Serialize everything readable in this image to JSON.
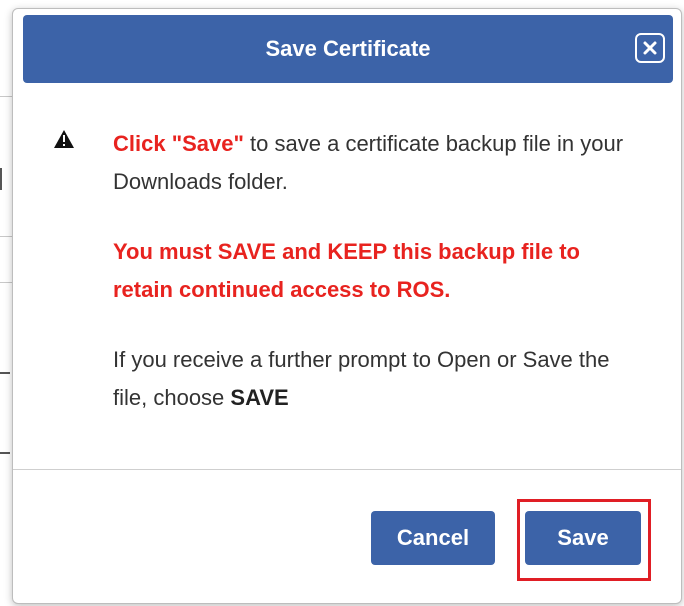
{
  "dialog": {
    "title": "Save Certificate",
    "close_icon": "close-icon"
  },
  "message": {
    "warning_icon": "warning-triangle-icon",
    "line1_highlight": "Click \"Save\"",
    "line1_rest": " to save a certificate backup file in your Downloads folder.",
    "warning_text": "You must SAVE and KEEP this backup file to retain continued access to ROS.",
    "prompt_text": "If you receive a further prompt to Open or Save the file, choose ",
    "prompt_strong": "SAVE"
  },
  "buttons": {
    "cancel_label": "Cancel",
    "save_label": "Save"
  },
  "colors": {
    "header_blue": "#3c63a8",
    "warning_red": "#e8231f",
    "highlight_red": "#e01e25"
  }
}
